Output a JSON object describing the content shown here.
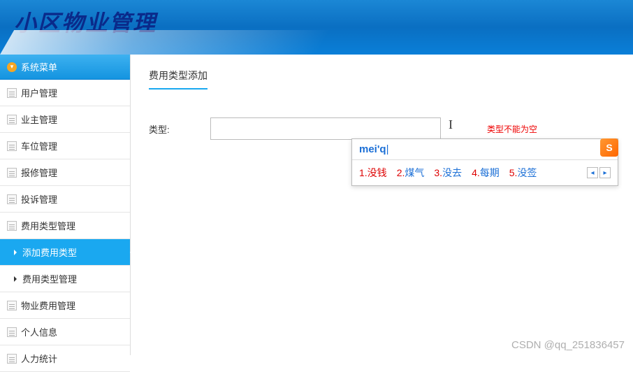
{
  "header": {
    "title": "小区物业管理"
  },
  "sidebar": {
    "menu_label": "系统菜单",
    "items": [
      {
        "label": "用户管理"
      },
      {
        "label": "业主管理"
      },
      {
        "label": "车位管理"
      },
      {
        "label": "报修管理"
      },
      {
        "label": "投诉管理"
      },
      {
        "label": "费用类型管理"
      }
    ],
    "subitems": [
      {
        "label": "添加费用类型",
        "active": true
      },
      {
        "label": "费用类型管理",
        "active": false
      }
    ],
    "items_after": [
      {
        "label": "物业费用管理"
      },
      {
        "label": "个人信息"
      },
      {
        "label": "人力统计"
      }
    ]
  },
  "content": {
    "title": "费用类型添加",
    "form": {
      "type_label": "类型:",
      "type_value": "",
      "error": "类型不能为空"
    }
  },
  "ime": {
    "input": "mei'q",
    "logo": "S",
    "candidates": [
      {
        "num": "1.",
        "word": "没钱"
      },
      {
        "num": "2.",
        "word": "煤气"
      },
      {
        "num": "3.",
        "word": "没去"
      },
      {
        "num": "4.",
        "word": "每期"
      },
      {
        "num": "5.",
        "word": "没签"
      }
    ]
  },
  "watermark": "CSDN @qq_251836457"
}
